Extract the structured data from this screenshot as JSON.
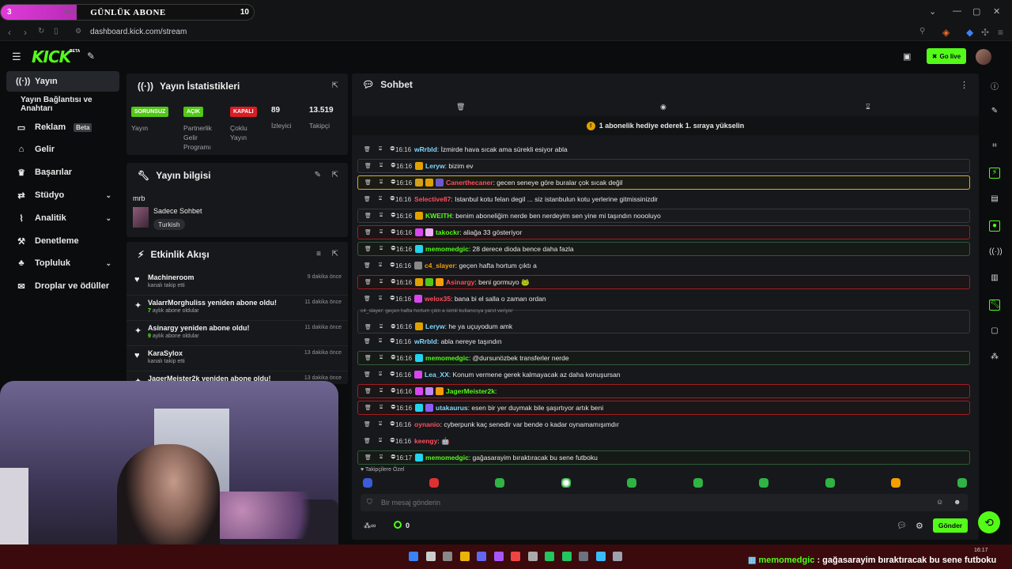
{
  "overlay": {
    "goal_title": "GÜNLÜK ABONE",
    "goal_current": "3",
    "goal_target": "10",
    "goal_progress": 0.3,
    "bg_fragment": "oard"
  },
  "browser": {
    "url": "dashboard.kick.com/stream"
  },
  "topnav": {
    "logo": "KICK",
    "logo_badge": "BETA",
    "go_live_label": "Go live"
  },
  "sidebar": {
    "items": [
      {
        "label": "Yayın",
        "icon": "stream-icon"
      },
      {
        "label": "Yayın Bağlantısı ve Anahtarı",
        "icon": ""
      },
      {
        "label": "Reklam",
        "icon": "ad-icon",
        "badge": "Beta"
      },
      {
        "label": "Gelir",
        "icon": "bank-icon"
      },
      {
        "label": "Başarılar",
        "icon": "trophy-icon"
      },
      {
        "label": "Stüdyo",
        "icon": "studio-icon"
      },
      {
        "label": "Analitik",
        "icon": "analytics-icon"
      },
      {
        "label": "Denetleme",
        "icon": "hammer-icon"
      },
      {
        "label": "Topluluk",
        "icon": "community-icon"
      },
      {
        "label": "Droplar ve ödüller",
        "icon": "gift-icon"
      }
    ]
  },
  "stats": {
    "title": "Yayın İstatistikleri",
    "items": [
      {
        "badge": "SORUNSUZ",
        "label": "Yayın",
        "color": "#53c718"
      },
      {
        "badge": "AÇIK",
        "label": "Partnerlik Gelir Programı",
        "color": "#53c718"
      },
      {
        "badge": "KAPALI",
        "label": "Çoklu Yayın",
        "color": "#d91e26"
      },
      {
        "value": "89",
        "label": "İzleyici"
      },
      {
        "value": "13.519",
        "label": "Takipçi"
      }
    ]
  },
  "info": {
    "title": "Yayın bilgisi",
    "stream_title": "mrb",
    "category": "Sadece Sohbet",
    "tag": "Turkish"
  },
  "activity": {
    "title": "Etkinlik Akışı",
    "items": [
      {
        "name": "Machineroom",
        "sub": "kanalı takip etti",
        "time": "9 dakika önce",
        "icon": "heart-icon"
      },
      {
        "name": "ValarrMorghuliss yeniden abone oldu!",
        "sub_num": "7",
        "sub": "aylık abone oldular",
        "time": "11 dakika önce",
        "icon": "star-icon"
      },
      {
        "name": "Asinargy yeniden abone oldu!",
        "sub_num": "9",
        "sub": "aylık abone oldular",
        "time": "11 dakika önce",
        "icon": "star-icon"
      },
      {
        "name": "KaraSylox",
        "sub": "kanalı takip etti",
        "time": "13 dakika önce",
        "icon": "heart-icon"
      },
      {
        "name": "JagerMeister2k yeniden abone oldu!",
        "sub": "",
        "time": "13 dakika önce",
        "icon": "star-icon"
      }
    ]
  },
  "chat": {
    "title": "Sohbet",
    "gift_banner": "1 abonelik hediye ederek 1. sıraya yükselin",
    "reply_context": "c4_slayer: geçen hafta hortum çıktı a isimli kullanıcıya yanıt veriyor",
    "messages": [
      {
        "time": "16:16",
        "user": "wRrbld",
        "color": "#7fd6ff",
        "text": ": İzmirde hava sıcak ama sürekli esiyor abla",
        "hl": "",
        "badges": []
      },
      {
        "time": "16:16",
        "user": "Leryw",
        "color": "#7fd6ff",
        "text": ": bizim ev",
        "hl": "grey",
        "badges": [
          "#e0a100"
        ]
      },
      {
        "time": "16:16",
        "user": "Canerthecaner",
        "color": "#ff4d5e",
        "text": ": gecen seneye göre buralar çok sıcak değil",
        "hl": "gold",
        "badges": [
          "#d4a017",
          "#e0a100",
          "#6a5acd"
        ]
      },
      {
        "time": "16:16",
        "user": "Selective87",
        "color": "#ff4d5e",
        "text": ": Istanbul kotu felan degil ... siz istanbulun kotu yerlerine gitmissinizdir",
        "hl": "",
        "badges": []
      },
      {
        "time": "16:16",
        "user": "KWEITH",
        "color": "#53fc18",
        "text": ": benim aboneliğim nerde ben nerdeyim sen yine mi taşındın noooluyo",
        "hl": "grey",
        "badges": [
          "#e0a100"
        ]
      },
      {
        "time": "16:16",
        "user": "takockr",
        "color": "#53fc18",
        "text": ": aliağa 33 gösteriyor",
        "hl": "red",
        "badges": [
          "#d946ef",
          "#f0abfc"
        ]
      },
      {
        "time": "16:16",
        "user": "memomedgic",
        "color": "#53fc18",
        "text": ": 28 derece dioda bence daha fazla",
        "hl": "green",
        "badges": [
          "#22d3ee"
        ]
      },
      {
        "time": "16:16",
        "user": "c4_slayer",
        "color": "#f59e0b",
        "text": ": geçen hafta hortum çıktı a",
        "hl": "",
        "badges": [
          "#888888"
        ]
      },
      {
        "time": "16:16",
        "user": "Asinargy",
        "color": "#ff4d5e",
        "text": ": beni gormuyo 🐸",
        "hl": "red",
        "badges": [
          "#e0a100",
          "#53c718",
          "#f59e0b"
        ]
      },
      {
        "time": "16:16",
        "user": "welox35",
        "color": "#ff4d5e",
        "text": ": bana bi el salla o zaman ordan",
        "hl": "",
        "badges": [
          "#d946ef"
        ]
      },
      {
        "time": "16:16",
        "user": "Leryw",
        "color": "#7fd6ff",
        "text": ": he ya uçuyodum amk",
        "hl": "grey",
        "badges": [
          "#e0a100"
        ],
        "reply": true
      },
      {
        "time": "16:16",
        "user": "wRrbld",
        "color": "#7fd6ff",
        "text": ": abla nereye taşındın",
        "hl": "",
        "badges": []
      },
      {
        "time": "16:16",
        "user": "memomedgic",
        "color": "#53fc18",
        "text": ": @dursunözbek transferler nerde",
        "hl": "green",
        "badges": [
          "#22d3ee"
        ]
      },
      {
        "time": "16:16",
        "user": "Lea_XX",
        "color": "#7fd6ff",
        "text": ": Konum vermene gerek kalmayacak az daha konuşursan",
        "hl": "",
        "badges": [
          "#d946ef"
        ]
      },
      {
        "time": "16:16",
        "user": "JagerMeister2k",
        "color": "#53fc18",
        "text": ":",
        "hl": "red",
        "badges": [
          "#d946ef",
          "#c084fc",
          "#f59e0b"
        ]
      },
      {
        "time": "16:16",
        "user": "utakaurus",
        "color": "#7fd6ff",
        "text": ": esen bir yer duymak bile şaşırtıyor artık beni",
        "hl": "red",
        "badges": [
          "#22d3ee",
          "#8b5cf6"
        ]
      },
      {
        "time": "16:16",
        "user": "oynanio",
        "color": "#ff4d5e",
        "text": ": cyberpunk kaç senedir var bende o kadar oynamamışımdır",
        "hl": "",
        "badges": []
      },
      {
        "time": "16:16",
        "user": "keengy",
        "color": "#ff4d5e",
        "text": ": 🤖",
        "hl": "",
        "badges": []
      },
      {
        "time": "16:17",
        "user": "memomedgic",
        "color": "#53fc18",
        "text": ": gağasarayim bıraktıracak bu sene futboku",
        "hl": "green",
        "badges": [
          "#22d3ee"
        ]
      }
    ],
    "emote_label": "Takipçilere Özel",
    "input_placeholder": "Bir mesaj gönderin",
    "points": "0",
    "send_label": "Gönder"
  },
  "ticker": {
    "user": "memomedgic",
    "text": " : gağasarayim bıraktıracak bu sene futboku"
  },
  "clock": {
    "time": "16:17"
  },
  "colors": {
    "brand": "#53fc18",
    "panel": "#17181b",
    "bg": "#0b0c0d",
    "taskbar": "#3a0a0d"
  }
}
